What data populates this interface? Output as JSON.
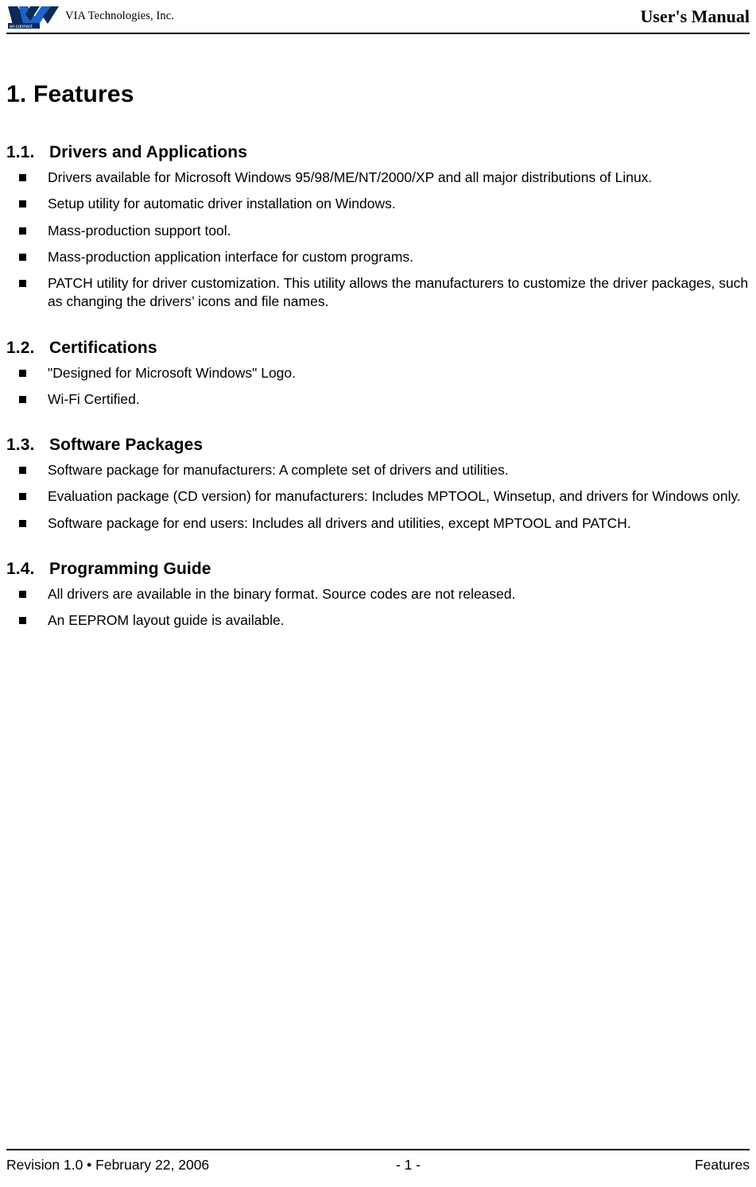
{
  "header": {
    "logo_icon": "via-logo-icon",
    "logo_sublabel": "wi-connect",
    "company": "VIA Technologies, Inc.",
    "doc_title": "User's Manual"
  },
  "document": {
    "chapter_title": "1. Features",
    "sections": [
      {
        "number": "1.1.",
        "title": "Drivers and Applications",
        "bullets": [
          "Drivers available for Microsoft Windows 95/98/ME/NT/2000/XP and all major distributions of Linux.",
          "Setup utility for automatic driver installation on Windows.",
          "Mass-production support tool.",
          "Mass-production application interface for custom programs.",
          "PATCH utility for driver customization. This utility allows the manufacturers to customize the driver packages, such as changing the drivers’ icons and file names."
        ]
      },
      {
        "number": "1.2.",
        "title": "Certifications",
        "bullets": [
          "\"Designed for Microsoft Windows\" Logo.",
          "Wi-Fi Certified."
        ]
      },
      {
        "number": "1.3.",
        "title": "Software Packages",
        "bullets": [
          "Software package for manufacturers: A complete set of drivers and utilities.",
          "Evaluation package (CD version) for manufacturers: Includes MPTOOL, Winsetup, and drivers for Windows only.",
          "Software package for end users: Includes all drivers and utilities, except MPTOOL and PATCH."
        ]
      },
      {
        "number": "1.4.",
        "title": "Programming Guide",
        "bullets": [
          "All drivers are available in the binary format. Source codes are not released.",
          "An EEPROM layout guide is available."
        ]
      }
    ]
  },
  "footer": {
    "revision": "Revision 1.0 • February 22, 2006",
    "page": "- 1 -",
    "chapter": "Features"
  },
  "colors": {
    "logo_blue": "#1b4fa0",
    "logo_dark": "#0b2a55",
    "rule": "#000000"
  }
}
